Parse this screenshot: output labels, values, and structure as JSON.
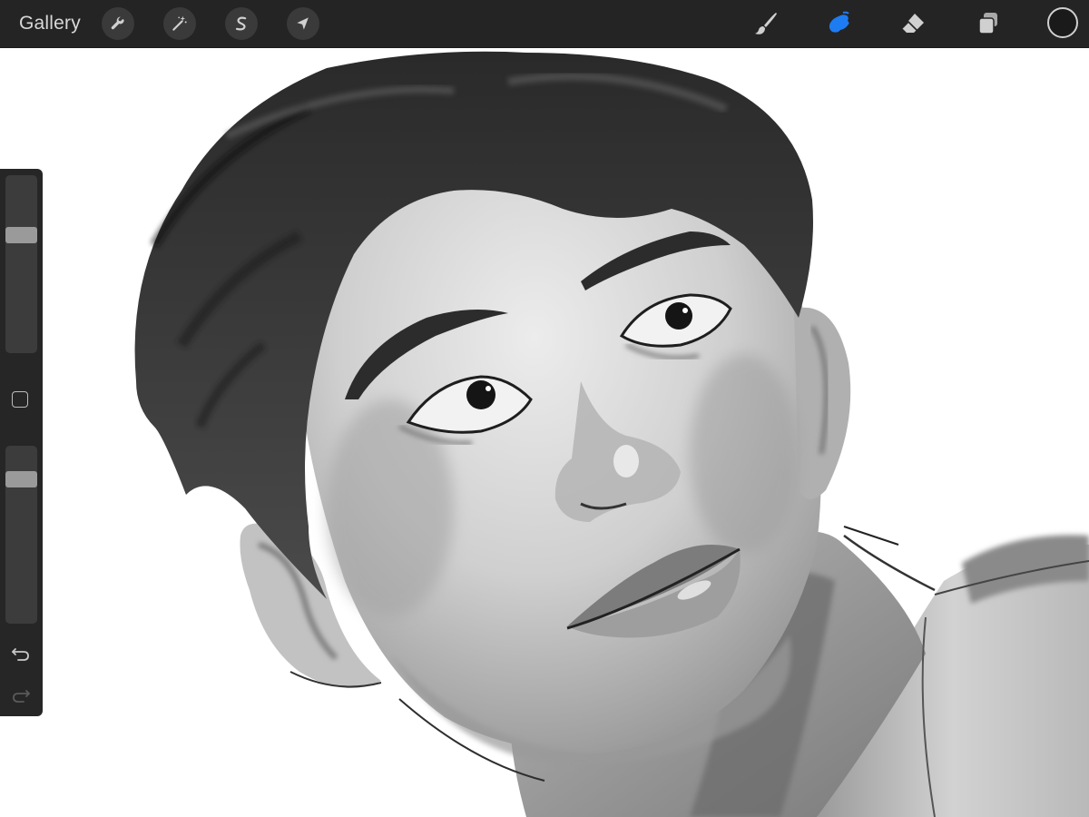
{
  "toolbar": {
    "gallery_label": "Gallery",
    "left_tools": [
      {
        "name": "actions",
        "icon": "wrench-icon"
      },
      {
        "name": "adjustments",
        "icon": "magic-wand-icon"
      },
      {
        "name": "selection",
        "icon": "selection-s-icon"
      },
      {
        "name": "transform",
        "icon": "arrow-cursor-icon"
      }
    ],
    "right_tools": [
      {
        "name": "brush",
        "icon": "brush-icon",
        "active": false
      },
      {
        "name": "smudge",
        "icon": "smudge-finger-icon",
        "active": true
      },
      {
        "name": "eraser",
        "icon": "eraser-icon",
        "active": false
      },
      {
        "name": "layers",
        "icon": "layers-icon",
        "active": false
      }
    ],
    "current_color": "#1a1a1a"
  },
  "sidebar": {
    "brush_size_level": 0.68,
    "opacity_level": 0.84,
    "modify_button_icon": "square-icon",
    "undo_icon": "undo-arrow-icon",
    "redo_icon": "redo-arrow-icon",
    "redo_enabled": false
  },
  "colors": {
    "toolbar_bg": "#242424",
    "sidebar_bg": "#262626",
    "active_tool": "#1e7cf2",
    "icon_default": "#d0d0d0",
    "canvas_bg": "#ffffff"
  }
}
